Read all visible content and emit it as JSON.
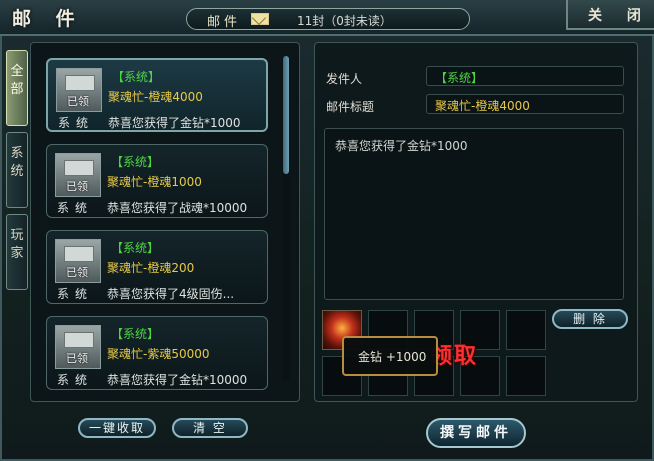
{
  "window": {
    "title": "邮 件",
    "counter_label": "邮件",
    "counter_value": "11封（0封未读）",
    "close_label": "关 闭"
  },
  "tabs": [
    {
      "label": "全部",
      "active": true
    },
    {
      "label": "系统",
      "active": false
    },
    {
      "label": "玩家",
      "active": false
    }
  ],
  "mails": [
    {
      "from": "【系统】",
      "subject": "聚魂忙-橙魂4000",
      "tag": "系统",
      "preview": "恭喜您获得了金钻*1000",
      "stamp": "已领",
      "selected": true
    },
    {
      "from": "【系统】",
      "subject": "聚魂忙-橙魂1000",
      "tag": "系统",
      "preview": "恭喜您获得了战魂*10000",
      "stamp": "已领",
      "selected": false
    },
    {
      "from": "【系统】",
      "subject": "聚魂忙-橙魂200",
      "tag": "系统",
      "preview": "恭喜您获得了4级固伤...",
      "stamp": "已领",
      "selected": false
    },
    {
      "from": "【系统】",
      "subject": "聚魂忙-紫魂50000",
      "tag": "系统",
      "preview": "恭喜您获得了金钻*10000",
      "stamp": "已领",
      "selected": false
    }
  ],
  "detail": {
    "sender_label": "发件人",
    "sender_value": "【系统】",
    "subject_label": "邮件标题",
    "subject_value": "聚魂忙-橙魂4000",
    "body": "恭喜您获得了金钻*1000",
    "claim_label": "领取",
    "tooltip": "金钻 +1000",
    "delete_label": "删 除"
  },
  "buttons": {
    "claim_all": "一键收取",
    "clear": "清 空",
    "compose": "撰写邮件"
  },
  "colors": {
    "system_green": "#4fd444",
    "subject_gold": "#e6c94a",
    "claim_red": "#ff2f2f"
  }
}
